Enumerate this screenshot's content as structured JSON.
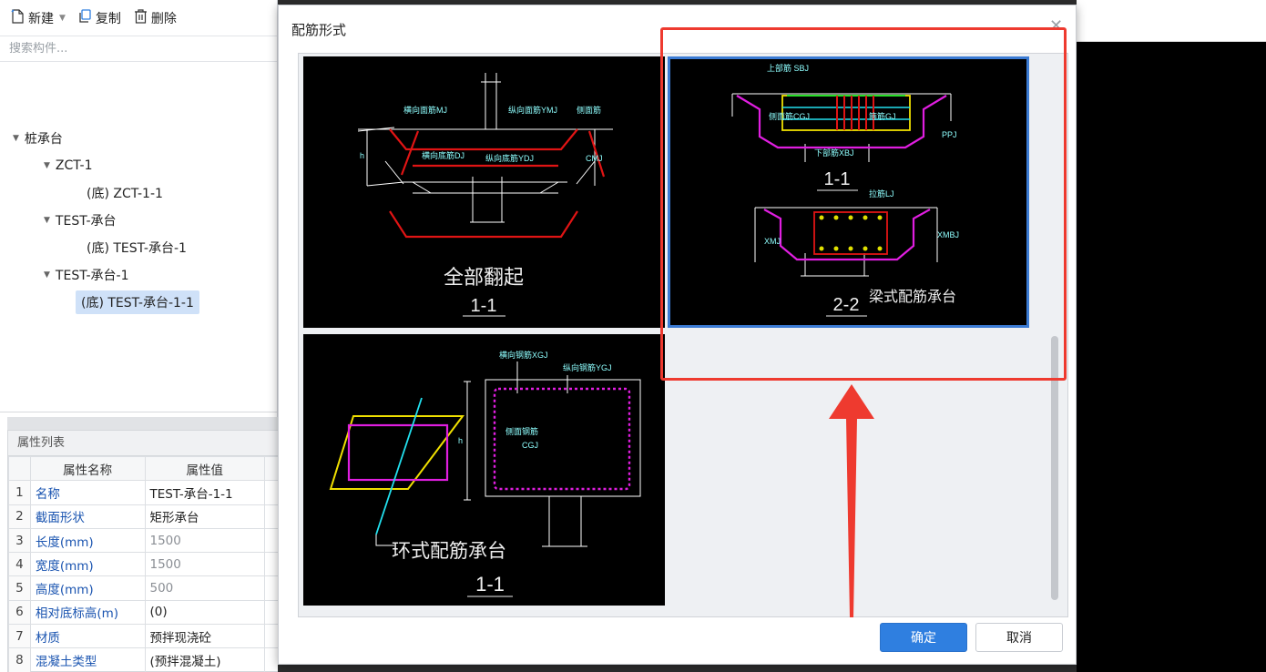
{
  "toolbar": {
    "new_label": "新建",
    "copy_label": "复制",
    "delete_label": "删除"
  },
  "search": {
    "placeholder": "搜索构件..."
  },
  "tree": {
    "root": "桩承台",
    "n1": "ZCT-1",
    "n1c": "(底) ZCT-1-1",
    "n2": "TEST-承台",
    "n2c": "(底) TEST-承台-1",
    "n3": "TEST-承台-1",
    "n3c": "(底) TEST-承台-1-1"
  },
  "props": {
    "title": "属性列表",
    "header": {
      "name": "属性名称",
      "value": "属性值"
    },
    "rows": [
      {
        "idx": "1",
        "name": "名称",
        "value": "TEST-承台-1-1"
      },
      {
        "idx": "2",
        "name": "截面形状",
        "value": "矩形承台"
      },
      {
        "idx": "3",
        "name": "长度(mm)",
        "value": "1500"
      },
      {
        "idx": "4",
        "name": "宽度(mm)",
        "value": "1500"
      },
      {
        "idx": "5",
        "name": "高度(mm)",
        "value": "500"
      },
      {
        "idx": "6",
        "name": "相对底标高(m)",
        "value": "(0)"
      },
      {
        "idx": "7",
        "name": "材质",
        "value": "预拌现浇砼"
      },
      {
        "idx": "8",
        "name": "混凝土类型",
        "value": "(预拌混凝土)"
      }
    ]
  },
  "dialog": {
    "title": "配筋形式",
    "ok": "确定",
    "cancel": "取消",
    "options": [
      {
        "caption": "全部翻起",
        "section": "1-1",
        "labels": {
          "l1": "横向面筋MJ",
          "l2": "纵向面筋YMJ",
          "l3": "横向底筋DJ",
          "l4": "纵向底筋YDJ",
          "l5": "CMJ",
          "l6": "h",
          "l7": "侧面筋"
        }
      },
      {
        "caption": "梁式配筋承台",
        "section_a": "1-1",
        "section_b": "2-2",
        "labels": {
          "l1": "上部筋 SBJ",
          "l2": "侧面筋CGJ",
          "l3": "箍筋GJ",
          "l4": "下部筋XBJ",
          "l5": "PPJ",
          "l6": "拉筋LJ",
          "l7": "XMJ",
          "l8": "XMBJ"
        }
      },
      {
        "caption": "环式配筋承台",
        "section": "1-1",
        "labels": {
          "l1": "横向钢筋XGJ",
          "l2": "纵向钢筋YGJ",
          "l3": "侧面钢筋",
          "l4": "CGJ",
          "l5": "h"
        }
      }
    ]
  },
  "colors": {
    "accent": "#2f7fe0",
    "annotation": "#ee3a2f",
    "drawing_bg": "#000000"
  }
}
